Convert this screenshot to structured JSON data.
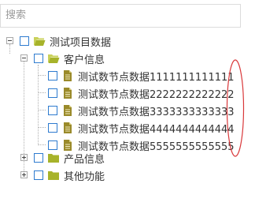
{
  "search": {
    "placeholder": "搜索"
  },
  "tree": {
    "root": "测试项目数据",
    "customer": "客户信息",
    "nodes": [
      "测试数节点数据1111111111111",
      "测试数节点数据2222222222222",
      "测试数节点数据3333333333333",
      "测试数节点数据4444444444444",
      "测试数节点数据5555555555555"
    ],
    "product": "产品信息",
    "other": "其他功能"
  },
  "colors": {
    "folder": "#a7b32a",
    "file": "#8a7a22",
    "checkbox_border": "#2e7bcf",
    "annotation": "#d9383a"
  }
}
